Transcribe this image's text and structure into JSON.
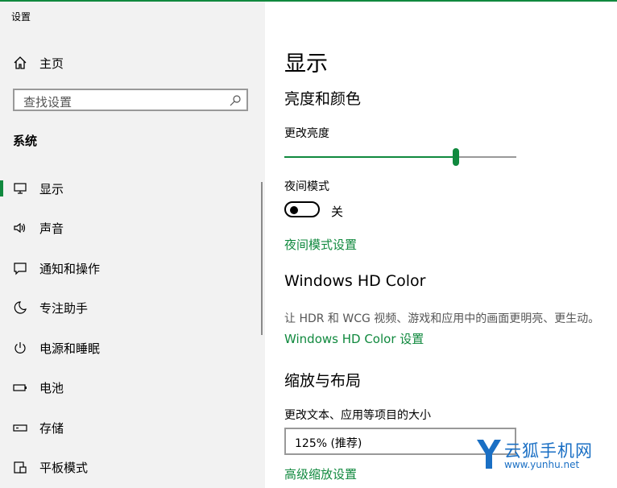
{
  "window": {
    "title": "设置",
    "accent": "#10893e"
  },
  "sidebar": {
    "home": {
      "label": "主页",
      "icon": "home-icon"
    },
    "search": {
      "placeholder": "查找设置",
      "icon": "search-icon"
    },
    "section_title": "系统",
    "items": [
      {
        "label": "显示",
        "icon": "monitor-icon",
        "active": true
      },
      {
        "label": "声音",
        "icon": "speaker-icon",
        "active": false
      },
      {
        "label": "通知和操作",
        "icon": "message-icon",
        "active": false
      },
      {
        "label": "专注助手",
        "icon": "moon-icon",
        "active": false
      },
      {
        "label": "电源和睡眠",
        "icon": "power-icon",
        "active": false
      },
      {
        "label": "电池",
        "icon": "battery-icon",
        "active": false
      },
      {
        "label": "存储",
        "icon": "storage-icon",
        "active": false
      },
      {
        "label": "平板模式",
        "icon": "tablet-icon",
        "active": false
      }
    ]
  },
  "main": {
    "title": "显示",
    "brightness_section": {
      "heading": "亮度和颜色",
      "brightness_label": "更改亮度",
      "brightness_value": 0.74,
      "night_light_label": "夜间模式",
      "night_light_state": "关",
      "night_light_settings_link": "夜间模式设置"
    },
    "hdr_section": {
      "heading": "Windows HD Color",
      "description": "让 HDR 和 WCG 视频、游戏和应用中的画面更明亮、更生动。",
      "settings_link": "Windows HD Color 设置"
    },
    "scale_section": {
      "heading": "缩放与布局",
      "scale_label": "更改文本、应用等项目的大小",
      "scale_value": "125% (推荐)",
      "advanced_link": "高级缩放设置"
    }
  },
  "watermark": {
    "brand": "云狐手机网",
    "url": "www.yunhu.net"
  }
}
